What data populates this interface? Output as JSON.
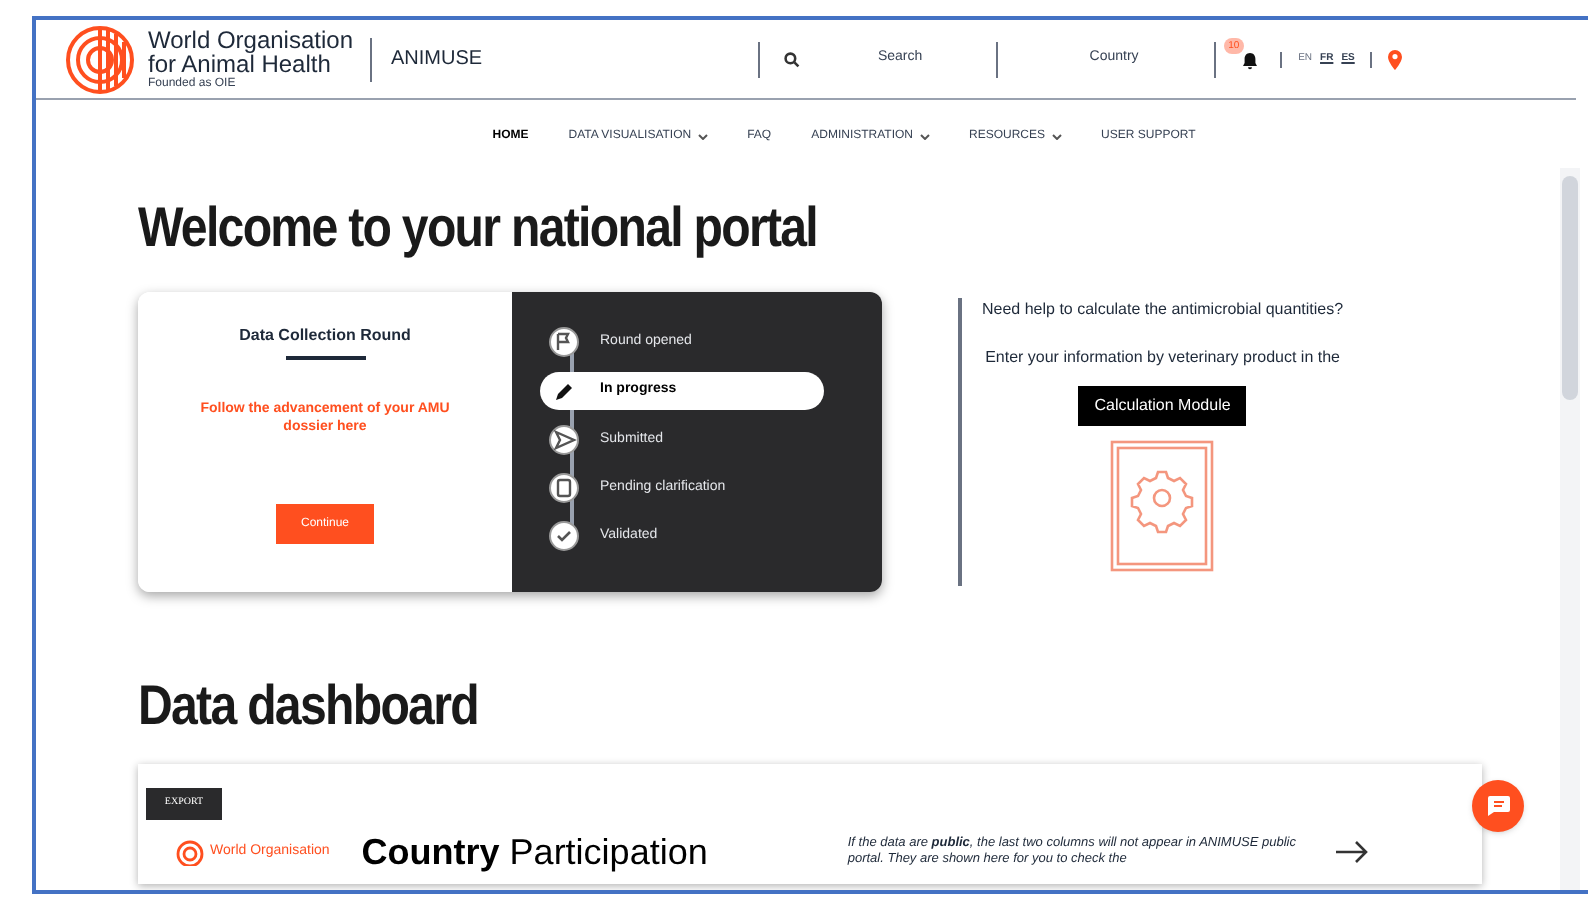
{
  "header": {
    "logo": {
      "line_1": "World Organisation",
      "line_2": "for Animal Health",
      "tagline": "Founded as OIE"
    },
    "app_name": "ANIMUSE",
    "search": {
      "placeholder": "Search"
    },
    "country": {
      "placeholder": "Country"
    },
    "notifications": {
      "count": "10"
    },
    "languages": [
      {
        "label": "EN",
        "selected": true
      },
      {
        "label": "FR",
        "selected": false
      },
      {
        "label": "ES",
        "selected": false
      }
    ]
  },
  "nav": [
    {
      "label": "HOME",
      "selected": true,
      "has_menu": false
    },
    {
      "label": "DATA VISUALISATION",
      "selected": false,
      "has_menu": true
    },
    {
      "label": "FAQ",
      "selected": false,
      "has_menu": false
    },
    {
      "label": "ADMINISTRATION",
      "selected": false,
      "has_menu": true
    },
    {
      "label": "RESOURCES",
      "selected": false,
      "has_menu": true
    },
    {
      "label": "USER SUPPORT",
      "selected": false,
      "has_menu": false
    }
  ],
  "title": "Welcome to your national portal",
  "round_card": {
    "title": "Data Collection Round",
    "message": "Follow the advancement of your AMU dossier here",
    "button": "Continue",
    "steps": [
      {
        "label": "Round opened",
        "kind": "flag",
        "selected": false
      },
      {
        "label": "In progress",
        "kind": "pencil",
        "selected": true
      },
      {
        "label": "Submitted",
        "kind": "send",
        "selected": false
      },
      {
        "label": "Pending clarification",
        "kind": "clipboard",
        "selected": false
      },
      {
        "label": "Validated",
        "kind": "check",
        "selected": false
      }
    ]
  },
  "help": {
    "question": "Need help to calculate the antimicrobial quantities?",
    "text": "Enter your information by veterinary product in the",
    "button": "Calculation Module"
  },
  "dashboard": {
    "title": "Data dashboard",
    "export_button": "EXPORT",
    "logo_text": "World Organisation",
    "heading": "**Country** Participation",
    "note": "If the data are **public**, the last two columns will not appear in ANIMUSE public portal. They are shown here for you to check the"
  }
}
